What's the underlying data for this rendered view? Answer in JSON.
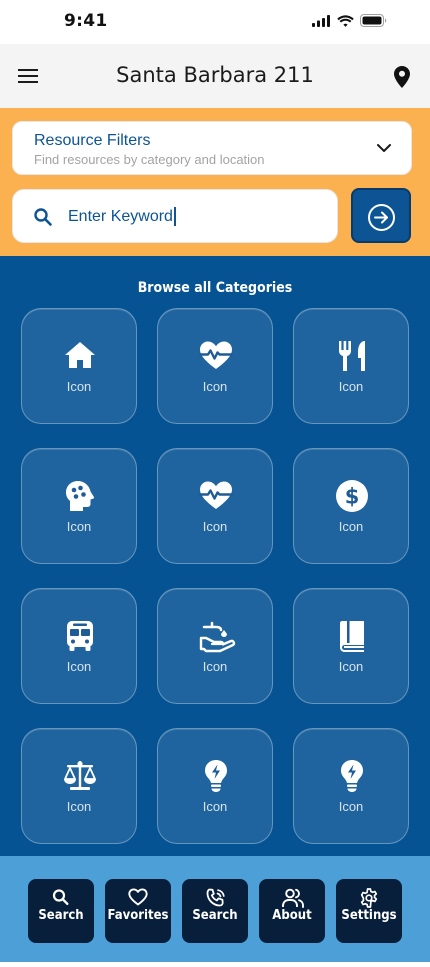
{
  "status_bar": {
    "time": "9:41"
  },
  "header": {
    "title": "Santa Barbara 211"
  },
  "filters": {
    "title": "Resource Filters",
    "subtitle": "Find resources by category and location"
  },
  "search": {
    "value": "Enter Keyword"
  },
  "categories": {
    "title": "Browse all Categories",
    "items": [
      {
        "icon": "home-icon",
        "label": "Icon"
      },
      {
        "icon": "heart-pulse-icon",
        "label": "Icon"
      },
      {
        "icon": "utensils-icon",
        "label": "Icon"
      },
      {
        "icon": "head-brain-icon",
        "label": "Icon"
      },
      {
        "icon": "heart-pulse-icon",
        "label": "Icon"
      },
      {
        "icon": "dollar-icon",
        "label": "Icon"
      },
      {
        "icon": "bus-icon",
        "label": "Icon"
      },
      {
        "icon": "hand-water-icon",
        "label": "Icon"
      },
      {
        "icon": "book-icon",
        "label": "Icon"
      },
      {
        "icon": "scale-icon",
        "label": "Icon"
      },
      {
        "icon": "lightbulb-icon",
        "label": "Icon"
      },
      {
        "icon": "lightbulb-bolt-icon",
        "label": "Icon"
      }
    ]
  },
  "bottom_nav": {
    "items": [
      {
        "icon": "search-icon",
        "label": "Search"
      },
      {
        "icon": "heart-outline-icon",
        "label": "Favorites"
      },
      {
        "icon": "phone-call-icon",
        "label": "Search"
      },
      {
        "icon": "users-icon",
        "label": "About"
      },
      {
        "icon": "gear-icon",
        "label": "Settings"
      }
    ]
  },
  "colors": {
    "search_band": "#fbb150",
    "primary_blue": "#0c5494",
    "main_background": "#065393",
    "bottom_nav_background": "#4d9fd8",
    "nav_button": "#081f3b"
  }
}
